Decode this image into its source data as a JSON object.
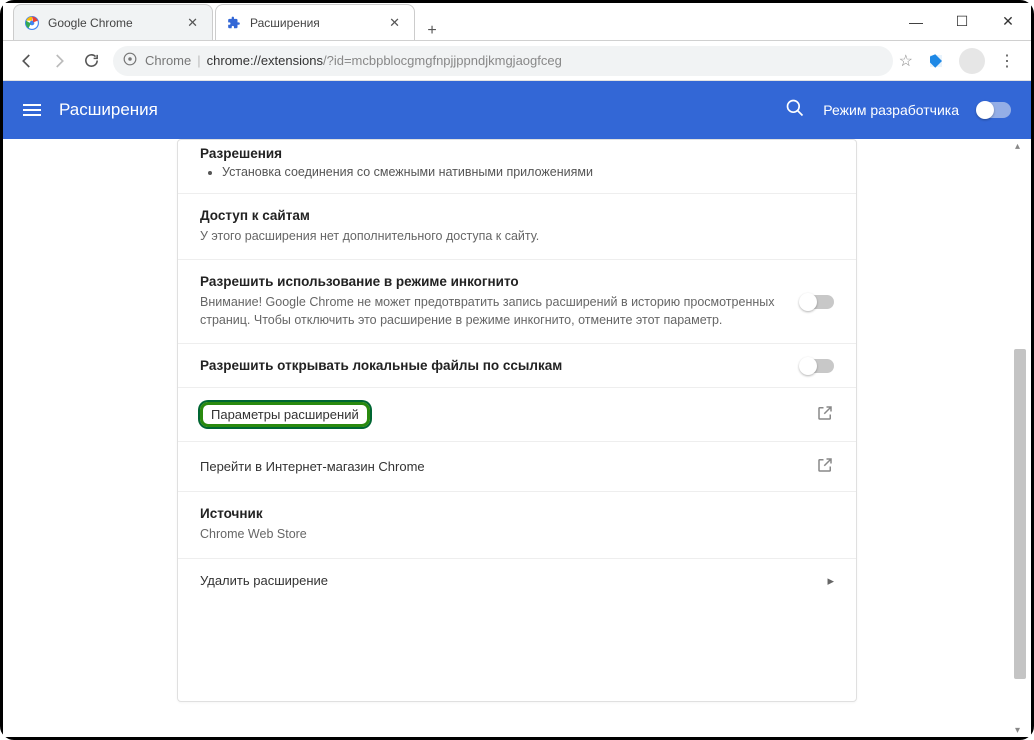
{
  "window": {
    "tabs": [
      {
        "title": "Google Chrome",
        "active": false,
        "icon": "chrome"
      },
      {
        "title": "Расширения",
        "active": true,
        "icon": "puzzle"
      }
    ]
  },
  "addressbar": {
    "prefix": "Chrome",
    "path": "chrome://extensions",
    "query": "/?id=mcbpblocgmgfnpjjppndjkmgjaogfceg"
  },
  "header": {
    "title": "Расширения",
    "dev_mode_label": "Режим разработчика"
  },
  "content": {
    "permissions": {
      "title": "Разрешения",
      "item0": "Установка соединения со смежными нативными приложениями"
    },
    "site_access": {
      "title": "Доступ к сайтам",
      "desc": "У этого расширения нет дополнительного доступа к сайту."
    },
    "incognito": {
      "title": "Разрешить использование в режиме инкогнито",
      "desc": "Внимание! Google Chrome не может предотвратить запись расширений в историю просмотренных страниц. Чтобы отключить это расширение в режиме инкогнито, отмените этот параметр."
    },
    "file_urls": {
      "title": "Разрешить открывать локальные файлы по ссылкам"
    },
    "options": {
      "label": "Параметры расширений"
    },
    "webstore": {
      "label": "Перейти в Интернет-магазин Chrome"
    },
    "source": {
      "title": "Источник",
      "value": "Chrome Web Store"
    },
    "remove": {
      "label": "Удалить расширение"
    }
  }
}
